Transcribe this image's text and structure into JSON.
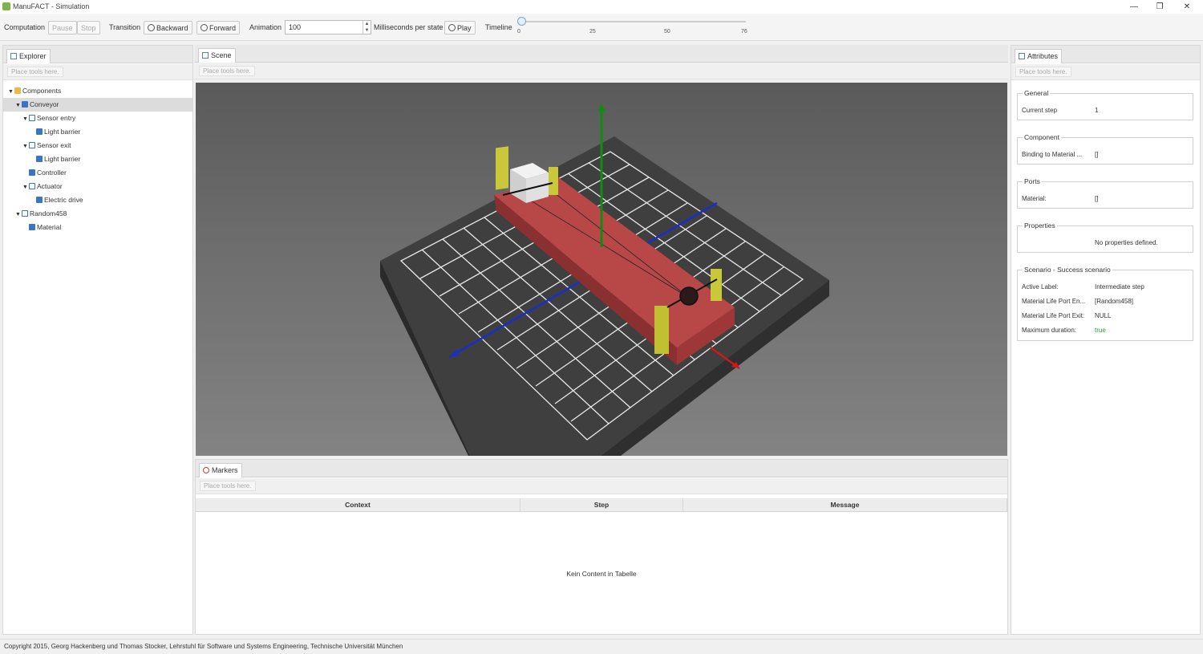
{
  "window": {
    "title": "ManuFACT - Simulation",
    "minimize": "—",
    "maximize": "❐",
    "close": "✕"
  },
  "toolbar": {
    "computation": "Computation",
    "pause": "Pause",
    "stop": "Stop",
    "transition": "Transition",
    "backward": "Backward",
    "forward": "Forward",
    "animation": "Animation",
    "animation_value": "100",
    "ms_per_state": "Milliseconds per state",
    "play": "Play",
    "timeline": "Timeline",
    "timeline_ticks": [
      "0",
      "25",
      "50",
      "76"
    ],
    "timeline_position": 0
  },
  "explorer": {
    "tab": "Explorer",
    "tools_placeholder": "Place tools here.",
    "tree": [
      {
        "label": "Components",
        "depth": 0,
        "expanded": true,
        "icon": "folder-icon"
      },
      {
        "label": "Conveyor",
        "depth": 1,
        "expanded": true,
        "icon": "component-icon",
        "selected": true
      },
      {
        "label": "Sensor entry",
        "depth": 2,
        "expanded": true,
        "icon": "subcomponent-icon"
      },
      {
        "label": "Light barrier",
        "depth": 3,
        "icon": "component-icon"
      },
      {
        "label": "Sensor exit",
        "depth": 2,
        "expanded": true,
        "icon": "subcomponent-icon"
      },
      {
        "label": "Light barrier",
        "depth": 3,
        "icon": "component-icon"
      },
      {
        "label": "Controller",
        "depth": 2,
        "icon": "component-icon"
      },
      {
        "label": "Actuator",
        "depth": 2,
        "expanded": true,
        "icon": "subcomponent-icon"
      },
      {
        "label": "Electric drive",
        "depth": 3,
        "icon": "component-icon"
      },
      {
        "label": "Random458",
        "depth": 1,
        "expanded": true,
        "icon": "subcomponent-icon"
      },
      {
        "label": "Material",
        "depth": 2,
        "icon": "component-icon"
      }
    ]
  },
  "scene": {
    "tab": "Scene",
    "tools_placeholder": "Place tools here."
  },
  "markers": {
    "tab": "Markers",
    "tools_placeholder": "Place tools here.",
    "columns": [
      "Context",
      "Step",
      "Message"
    ],
    "empty": "Kein Content in Tabelle"
  },
  "attributes": {
    "tab": "Attributes",
    "tools_placeholder": "Place tools here.",
    "general": {
      "title": "General",
      "current_step_label": "Current step",
      "current_step": "1"
    },
    "component": {
      "title": "Component",
      "binding_label": "Binding to Material ...",
      "binding_value": "[]"
    },
    "ports": {
      "title": "Ports",
      "material_label": "Material:",
      "material_value": "[]"
    },
    "properties": {
      "title": "Properties",
      "empty": "No properties defined."
    },
    "scenario": {
      "title": "Scenario - Success scenario",
      "rows": [
        {
          "key": "Active Label:",
          "value": "Intermediate step"
        },
        {
          "key": "Material Life Port En...",
          "value": "[Random458]"
        },
        {
          "key": "Material Life Port Exit:",
          "value": "NULL"
        },
        {
          "key": "Maximum duration:",
          "value": "true"
        }
      ],
      "true_color": "#2e9b2e"
    }
  },
  "statusbar": {
    "copyright": "Copyright 2015, Georg Hackenberg und Thomas Stocker, Lehrstuhl für Software und Systems Engineering, Technische Universität München"
  }
}
